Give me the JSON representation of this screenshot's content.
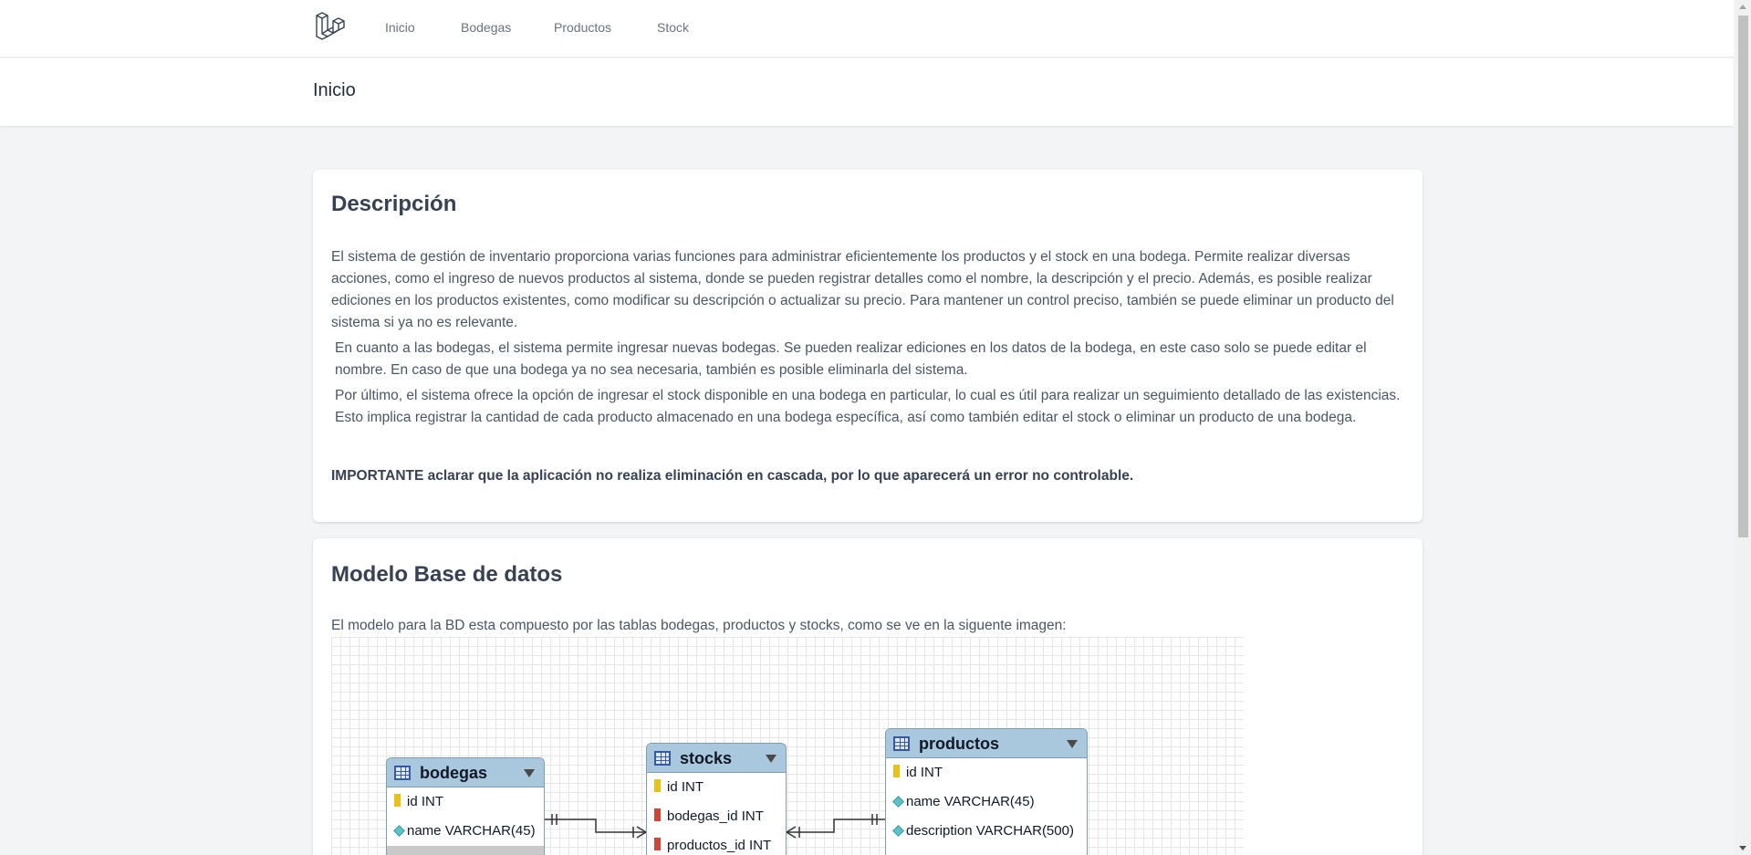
{
  "nav": {
    "logo_icon": "laravel-logo-icon",
    "links": [
      "Inicio",
      "Bodegas",
      "Productos",
      "Stock"
    ]
  },
  "header": {
    "title": "Inicio"
  },
  "description": {
    "title": "Descripción",
    "p1": "El sistema de gestión de inventario proporciona varias funciones para administrar eficientemente los productos y el stock en una bodega. Permite realizar diversas acciones, como el ingreso de nuevos productos al sistema, donde se pueden registrar detalles como el nombre, la descripción y el precio. Además, es posible realizar ediciones en los productos existentes, como modificar su descripción o actualizar su precio. Para mantener un control preciso, también se puede eliminar un producto del sistema si ya no es relevante.",
    "p2": "En cuanto a las bodegas, el sistema permite ingresar nuevas bodegas. Se pueden realizar ediciones en los datos de la bodega, en este caso solo se puede editar el nombre. En caso de que una bodega ya no sea necesaria, también es posible eliminarla del sistema.",
    "p3": "Por último, el sistema ofrece la opción de ingresar el stock disponible en una bodega en particular, lo cual es útil para realizar un seguimiento detallado de las existencias. Esto implica registrar la cantidad de cada producto almacenado en una bodega específica, así como también editar el stock o eliminar un producto de una bodega.",
    "important": "IMPORTANTE aclarar que la aplicación no realiza eliminación en cascada, por lo que aparecerá un error no controlable."
  },
  "db_model": {
    "title": "Modelo Base de datos",
    "intro": "El modelo para la BD esta compuesto por las tablas bodegas, productos y stocks, como se ve en la siguente imagen:",
    "tables": {
      "bodegas": {
        "name": "bodegas",
        "columns": [
          "id INT",
          "name VARCHAR(45)"
        ]
      },
      "stocks": {
        "name": "stocks",
        "columns": [
          "id INT",
          "bodegas_id INT",
          "productos_id INT"
        ]
      },
      "productos": {
        "name": "productos",
        "columns": [
          "id INT",
          "name VARCHAR(45)",
          "description VARCHAR(500)"
        ]
      }
    }
  },
  "colors": {
    "accent_header": "#a9c7dd",
    "page_bg": "#f3f4f6",
    "pk_key": "#e8c21a",
    "fk_key": "#d0453a"
  }
}
